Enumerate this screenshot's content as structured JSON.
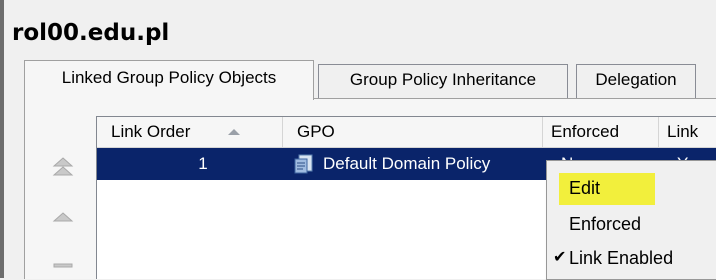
{
  "window": {
    "title": "rol00.edu.pl"
  },
  "tabs": [
    {
      "label": "Linked Group Policy Objects",
      "active": true
    },
    {
      "label": "Group Policy Inheritance",
      "active": false
    },
    {
      "label": "Delegation",
      "active": false
    }
  ],
  "list": {
    "columns": [
      "Link Order",
      "GPO",
      "Enforced",
      "Link"
    ],
    "rows": [
      {
        "link_order": "1",
        "gpo": "Default Domain Policy",
        "enforced": "No",
        "link_enabled": "Yes"
      }
    ]
  },
  "context_menu": {
    "items": [
      {
        "label": "Edit",
        "highlighted": true,
        "checked": false
      },
      {
        "label": "Enforced",
        "highlighted": false,
        "checked": false
      },
      {
        "label": "Link Enabled",
        "highlighted": false,
        "checked": true
      }
    ],
    "check_glyph": "✔"
  },
  "colors": {
    "selection": "#0a246a",
    "highlight": "#f2ef3c"
  }
}
